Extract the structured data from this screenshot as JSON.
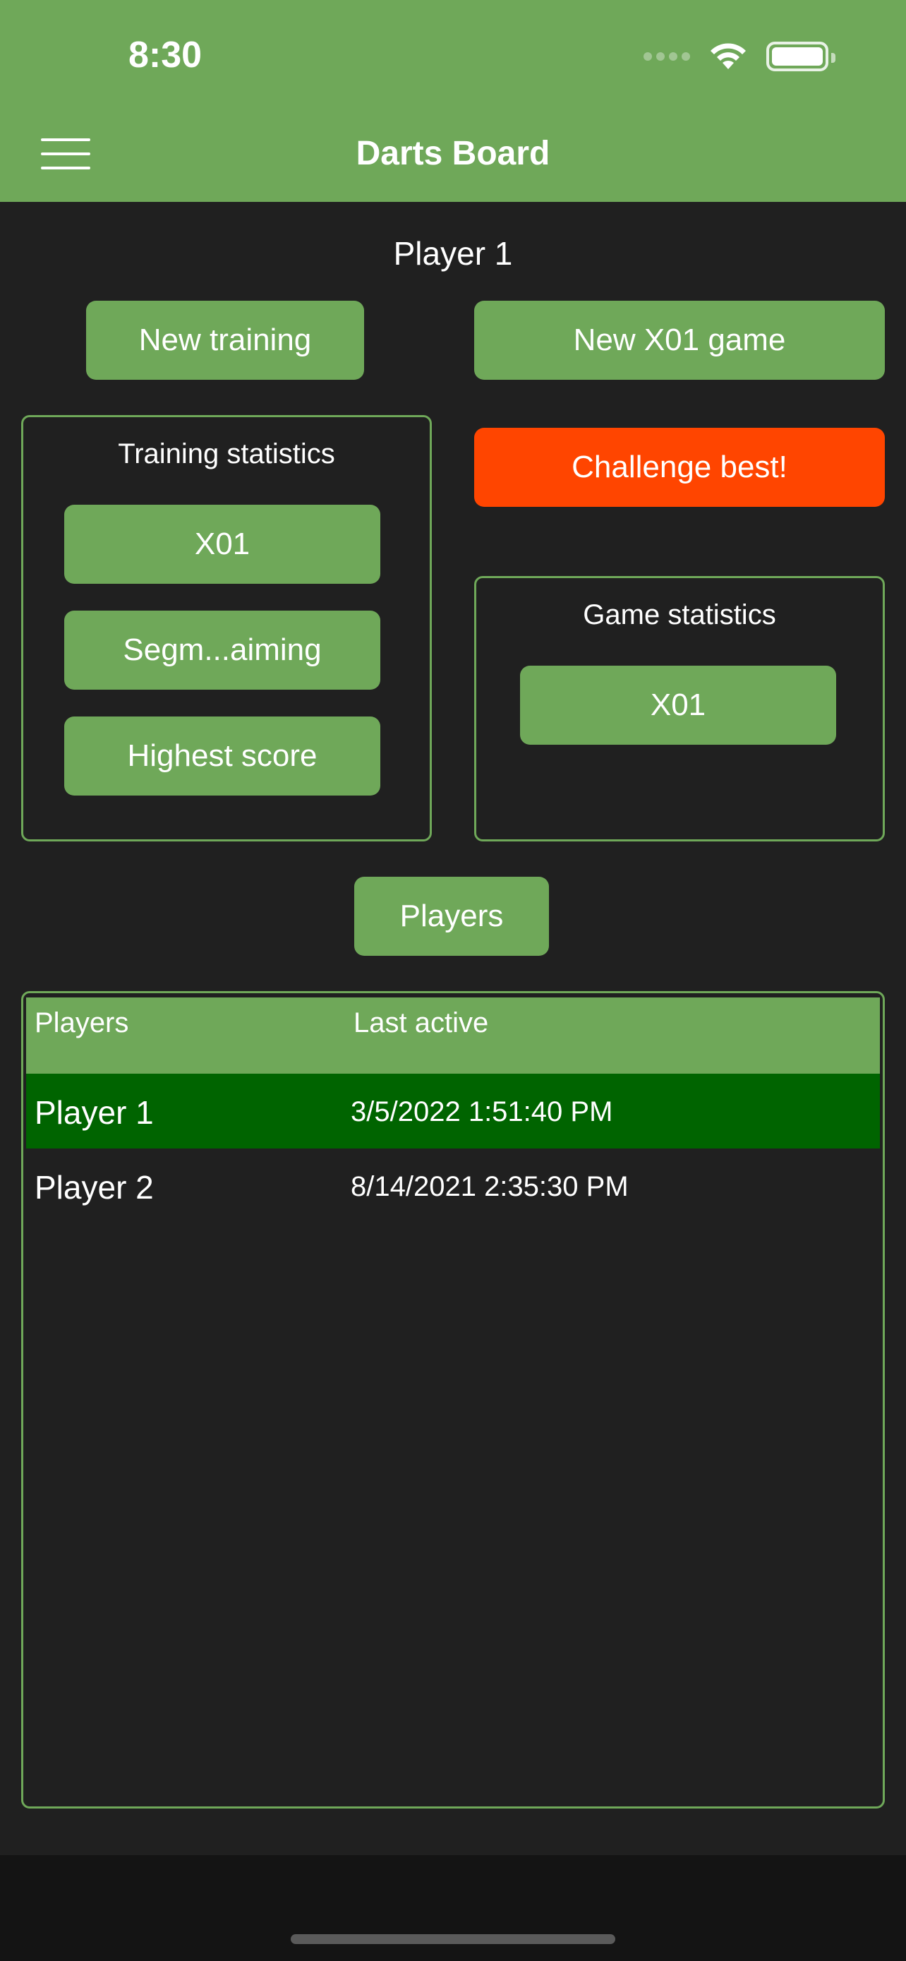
{
  "status_bar": {
    "time": "8:30",
    "icons": [
      "signal-icon",
      "wifi-icon",
      "battery-icon"
    ]
  },
  "header": {
    "title": "Darts Board",
    "menu_icon": "hamburger-menu-icon"
  },
  "current_player": "Player 1",
  "actions": {
    "new_training": "New training",
    "new_x01_game": "New X01 game",
    "challenge_best": "Challenge best!",
    "players": "Players"
  },
  "training_statistics": {
    "title": "Training statistics",
    "buttons": [
      "X01",
      "Segm...aiming",
      "Highest score"
    ]
  },
  "game_statistics": {
    "title": "Game statistics",
    "buttons": [
      "X01"
    ]
  },
  "players_table": {
    "columns": [
      "Players",
      "Last active"
    ],
    "rows": [
      {
        "name": "Player 1",
        "last_active": "3/5/2022 1:51:40 PM",
        "selected": true
      },
      {
        "name": "Player 2",
        "last_active": "8/14/2021 2:35:30 PM",
        "selected": false
      }
    ]
  },
  "colors": {
    "primary": "#6fa859",
    "accent": "#ff4500",
    "selected_row": "#006400",
    "background": "#202020"
  }
}
